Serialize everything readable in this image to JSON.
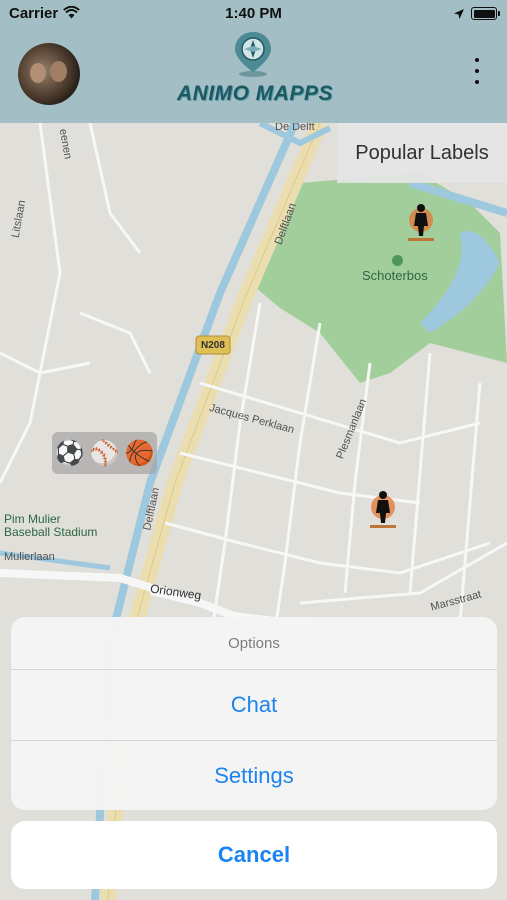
{
  "status_bar": {
    "carrier": "Carrier",
    "time": "1:40 PM",
    "wifi_icon": "wifi-icon",
    "location_icon": "location-arrow-icon",
    "battery_icon": "battery-icon"
  },
  "header": {
    "avatar_icon": "avatar",
    "logo_text": "ANIMO MAPPS",
    "logo_icon": "map-pin-compass-icon",
    "menu_icon": "more-vertical-icon",
    "background": "#a9c6cc"
  },
  "map": {
    "popular_labels": "Popular Labels",
    "sport_chip": [
      "⚽",
      "⚾",
      "🏀"
    ],
    "labels": {
      "de_delft": "De Delft",
      "delftlaan_top": "Delftlaan",
      "delftlaan_bottom": "Delftlaan",
      "schoterbos": "Schoterbos",
      "n208": "N208",
      "jacques_perklaan": "Jacques Perklaan",
      "plesmanlaan": "Plesmanlaan",
      "litslaan": "Litslaan",
      "eenen": "eenen",
      "pim_mulier": "Pim Mulier",
      "baseball_stadium": "Baseball Stadium",
      "mulierlaan": "Mulierlaan",
      "orionweg": "Orionweg",
      "marsstraat": "Marsstraat"
    },
    "colors": {
      "land": "#eceae4",
      "park": "#a8d5a0",
      "water": "#a3cfe6",
      "road": "#f2e6b6"
    }
  },
  "action_sheet": {
    "title": "Options",
    "buttons": [
      "Chat",
      "Settings"
    ],
    "cancel": "Cancel",
    "accent": "#1b84f0"
  }
}
